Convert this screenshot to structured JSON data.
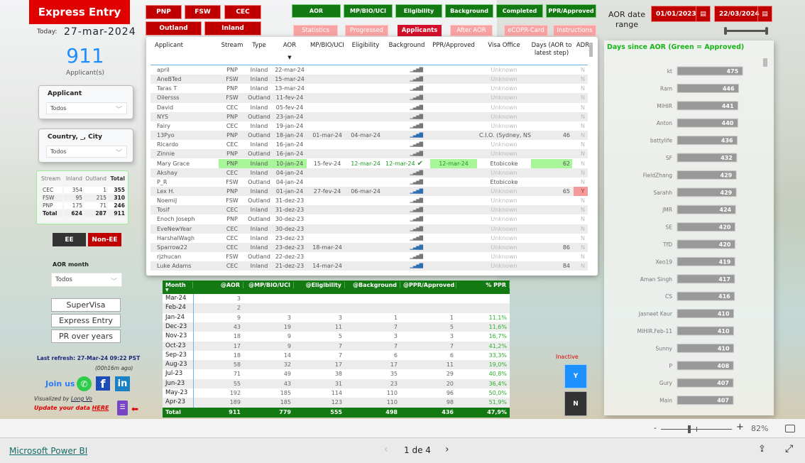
{
  "app": {
    "title": "Express Entry",
    "today_label": "Today:",
    "today": "27-mar-2024",
    "count": "911",
    "count_label": "Applicant(s)"
  },
  "filters": {
    "applicant": {
      "label": "Applicant",
      "value": "Todos"
    },
    "country": {
      "label": "Country, _, City",
      "value": "Todos"
    },
    "aor_month": {
      "label": "AOR month",
      "value": "Todos"
    }
  },
  "stream_matrix": {
    "headers": [
      "Stream",
      "Inland",
      "Outland",
      "Total"
    ],
    "rows": [
      [
        "CEC",
        "354",
        "1",
        "355"
      ],
      [
        "FSW",
        "95",
        "215",
        "310"
      ],
      [
        "PNP",
        "175",
        "71",
        "246"
      ],
      [
        "Total",
        "624",
        "287",
        "911"
      ]
    ]
  },
  "ee_toggle": {
    "ee": "EE",
    "non_ee": "Non-EE"
  },
  "nav_buttons": [
    "SuperVisa",
    "Express Entry",
    "PR over years"
  ],
  "refresh": {
    "text": "Last refresh: 27-Mar-24 09:22 PST",
    "ago": "(00h16m ago)"
  },
  "social": {
    "join": "Join us",
    "icons": [
      "whatsapp-icon",
      "facebook-icon",
      "linkedin-icon"
    ]
  },
  "credits": {
    "prefix": "Visualized by ",
    "author": "Long Vo",
    "update_prefix": "Update your data ",
    "update_link": "HERE"
  },
  "stream_buttons": [
    "PNP",
    "FSW",
    "CEC"
  ],
  "type_buttons": [
    "Outland",
    "Inland"
  ],
  "stage_buttons": [
    "AOR",
    "MP/BIO/UCI",
    "Eligibility",
    "Background",
    "Completed",
    "PPR/Approved"
  ],
  "page_tabs": [
    {
      "label": "Statistics"
    },
    {
      "label": "Progressed"
    },
    {
      "label": "Applicants",
      "active": true
    },
    {
      "label": "After AOR"
    },
    {
      "label": "eCOPR-Card"
    },
    {
      "label": "Instructions"
    }
  ],
  "date_range": {
    "label": "AOR date range",
    "start": "01/01/2023",
    "end": "22/03/2024"
  },
  "applicants_table": {
    "headers": [
      "Applicant",
      "Stream",
      "Type",
      "AOR",
      "MP/BIO/UCI",
      "Eligibility",
      "Background",
      "PPR/Approved",
      "Visa Office",
      "Days (AOR to latest step)",
      "ADR"
    ],
    "sort_column": "AOR",
    "rows": [
      {
        "applicant": "april",
        "stream": "PNP",
        "type": "Inland",
        "aor": "22-mar-24",
        "mp": "",
        "elig": "",
        "bg": "",
        "ppr": "",
        "office": "Unknown",
        "days": "",
        "adr": "N"
      },
      {
        "applicant": "AneBTed",
        "stream": "FSW",
        "type": "Inland",
        "aor": "15-mar-24",
        "mp": "",
        "elig": "",
        "bg": "",
        "ppr": "",
        "office": "Unknown",
        "days": "",
        "adr": "N"
      },
      {
        "applicant": "Taras T",
        "stream": "PNP",
        "type": "Inland",
        "aor": "13-mar-24",
        "mp": "",
        "elig": "",
        "bg": "",
        "ppr": "",
        "office": "Unknown",
        "days": "",
        "adr": "N"
      },
      {
        "applicant": "Oilersss",
        "stream": "FSW",
        "type": "Outland",
        "aor": "11-fev-24",
        "mp": "",
        "elig": "",
        "bg": "",
        "ppr": "",
        "office": "Unknown",
        "days": "",
        "adr": "N"
      },
      {
        "applicant": "David",
        "stream": "CEC",
        "type": "Inland",
        "aor": "05-fev-24",
        "mp": "",
        "elig": "",
        "bg": "",
        "ppr": "",
        "office": "Unknown",
        "days": "",
        "adr": "N"
      },
      {
        "applicant": "NYS",
        "stream": "PNP",
        "type": "Outland",
        "aor": "23-jan-24",
        "mp": "",
        "elig": "",
        "bg": "",
        "ppr": "",
        "office": "Unknown",
        "days": "",
        "adr": "N"
      },
      {
        "applicant": "Fairy",
        "stream": "CEC",
        "type": "Inland",
        "aor": "19-jan-24",
        "mp": "",
        "elig": "",
        "bg": "",
        "ppr": "",
        "office": "Unknown",
        "days": "",
        "adr": "N"
      },
      {
        "applicant": "13Pyo",
        "stream": "PNP",
        "type": "Outland",
        "aor": "18-jan-24",
        "mp": "01-mar-24",
        "elig": "04-mar-24",
        "bg": "",
        "ppr": "",
        "office": "C.I.O. (Sydney, NS)",
        "days": "46",
        "adr": "N",
        "progress": true
      },
      {
        "applicant": "Ricardo",
        "stream": "CEC",
        "type": "Inland",
        "aor": "16-jan-24",
        "mp": "",
        "elig": "",
        "bg": "",
        "ppr": "",
        "office": "Unknown",
        "days": "",
        "adr": "N"
      },
      {
        "applicant": "Zinnie",
        "stream": "PNP",
        "type": "Outland",
        "aor": "16-jan-24",
        "mp": "",
        "elig": "",
        "bg": "",
        "ppr": "",
        "office": "Unknown",
        "days": "",
        "adr": "N"
      },
      {
        "applicant": "Mary Grace",
        "stream": "PNP",
        "type": "Inland",
        "aor": "10-jan-24",
        "mp": "15-fev-24",
        "elig": "12-mar-24",
        "bg": "12-mar-24",
        "ppr": "12-mar-24",
        "office": "Etobicoke",
        "days": "62",
        "adr": "N",
        "approved": true
      },
      {
        "applicant": "Akshay",
        "stream": "CEC",
        "type": "Inland",
        "aor": "04-jan-24",
        "mp": "",
        "elig": "",
        "bg": "",
        "ppr": "",
        "office": "Unknown",
        "days": "",
        "adr": "N"
      },
      {
        "applicant": "P_R",
        "stream": "FSW",
        "type": "Outland",
        "aor": "04-jan-24",
        "mp": "",
        "elig": "",
        "bg": "",
        "ppr": "",
        "office": "Etobicoke",
        "days": "",
        "adr": "N",
        "known_office": true
      },
      {
        "applicant": "Lex H.",
        "stream": "PNP",
        "type": "Inland",
        "aor": "01-jan-24",
        "mp": "27-fev-24",
        "elig": "06-mar-24",
        "bg": "",
        "ppr": "",
        "office": "Unknown",
        "days": "65",
        "adr": "Y",
        "progress": true
      },
      {
        "applicant": "NoemiJ",
        "stream": "FSW",
        "type": "Outland",
        "aor": "31-dez-23",
        "mp": "",
        "elig": "",
        "bg": "",
        "ppr": "",
        "office": "Unknown",
        "days": "",
        "adr": "N"
      },
      {
        "applicant": "Tosif",
        "stream": "CEC",
        "type": "Inland",
        "aor": "31-dez-23",
        "mp": "",
        "elig": "",
        "bg": "",
        "ppr": "",
        "office": "Unknown",
        "days": "",
        "adr": "N"
      },
      {
        "applicant": "Enoch Joseph",
        "stream": "PNP",
        "type": "Outland",
        "aor": "30-dez-23",
        "mp": "",
        "elig": "",
        "bg": "",
        "ppr": "",
        "office": "Unknown",
        "days": "",
        "adr": "N"
      },
      {
        "applicant": "EveNewYear",
        "stream": "CEC",
        "type": "Inland",
        "aor": "30-dez-23",
        "mp": "",
        "elig": "",
        "bg": "",
        "ppr": "",
        "office": "Unknown",
        "days": "",
        "adr": "N"
      },
      {
        "applicant": "HarshalWagh",
        "stream": "CEC",
        "type": "Inland",
        "aor": "23-dez-23",
        "mp": "",
        "elig": "",
        "bg": "",
        "ppr": "",
        "office": "Unknown",
        "days": "",
        "adr": "N"
      },
      {
        "applicant": "Sparrow22",
        "stream": "CEC",
        "type": "Inland",
        "aor": "23-dez-23",
        "mp": "18-mar-24",
        "elig": "",
        "bg": "",
        "ppr": "",
        "office": "Unknown",
        "days": "86",
        "adr": "N",
        "progress": true
      },
      {
        "applicant": "rjzhucan",
        "stream": "FSW",
        "type": "Outland",
        "aor": "22-dez-23",
        "mp": "",
        "elig": "",
        "bg": "",
        "ppr": "",
        "office": "Unknown",
        "days": "",
        "adr": "N"
      },
      {
        "applicant": "Luke Adams",
        "stream": "CEC",
        "type": "Inland",
        "aor": "21-dez-23",
        "mp": "14-mar-24",
        "elig": "",
        "bg": "",
        "ppr": "",
        "office": "Unknown",
        "days": "84",
        "adr": "N",
        "progress": true
      }
    ]
  },
  "monthly_table": {
    "headers": [
      "Month",
      "@AOR",
      "@MP/BIO/UCI",
      "@Eligibility",
      "@Background",
      "@PPR/Approved",
      "% PPR"
    ],
    "rows": [
      [
        "Mar-24",
        "3",
        "",
        "",
        "",
        "",
        ""
      ],
      [
        "Feb-24",
        "2",
        "",
        "",
        "",
        "",
        ""
      ],
      [
        "Jan-24",
        "9",
        "3",
        "3",
        "1",
        "1",
        "11,1%"
      ],
      [
        "Dec-23",
        "43",
        "19",
        "11",
        "7",
        "5",
        "11,6%"
      ],
      [
        "Nov-23",
        "18",
        "9",
        "5",
        "3",
        "3",
        "16,7%"
      ],
      [
        "Oct-23",
        "17",
        "9",
        "7",
        "7",
        "7",
        "41,2%"
      ],
      [
        "Sep-23",
        "18",
        "14",
        "7",
        "6",
        "6",
        "33,3%"
      ],
      [
        "Aug-23",
        "58",
        "32",
        "17",
        "17",
        "11",
        "19,0%"
      ],
      [
        "Jul-23",
        "71",
        "49",
        "38",
        "35",
        "29",
        "40,8%"
      ],
      [
        "Jun-23",
        "55",
        "43",
        "31",
        "23",
        "20",
        "36,4%"
      ],
      [
        "May-23",
        "192",
        "185",
        "114",
        "110",
        "96",
        "50,0%"
      ],
      [
        "Apr-23",
        "189",
        "185",
        "123",
        "110",
        "98",
        "51,9%"
      ]
    ],
    "total": [
      "Total",
      "911",
      "779",
      "555",
      "498",
      "436",
      "47,9%"
    ]
  },
  "chart_data": {
    "type": "bar",
    "orientation": "horizontal",
    "title": "Days since AOR (Green = Approved)",
    "categories": [
      "kt",
      "Ram",
      "MIHIR",
      "Anton",
      "battylife",
      "SF",
      "FieldZhang",
      "Sarahh",
      "JMR",
      "SE",
      "TfD",
      "Xeo19",
      "Aman Singh",
      "CS",
      "Jasneet Kaur",
      "MIHIR.Feb-11",
      "Sunny",
      "P",
      "Gury",
      "Main"
    ],
    "values": [
      475,
      446,
      441,
      440,
      436,
      432,
      429,
      429,
      424,
      420,
      420,
      419,
      417,
      416,
      410,
      410,
      410,
      408,
      407,
      407
    ],
    "bar_color": "#999999",
    "grid": false,
    "data_labels": true
  },
  "inactive": {
    "label": "Inactive",
    "yes": "Y",
    "no": "N"
  },
  "zoom": {
    "minus": "-",
    "plus": "+",
    "level": "82%",
    "value_fraction": 0.4
  },
  "footer": {
    "brand": "Microsoft Power BI",
    "page": "1 de 4"
  },
  "colors": {
    "brand_red": "#c00000",
    "green": "#137a13",
    "blue": "#1e90ff",
    "approved": "#a9f59a",
    "adr_yes": "#f59a9a"
  }
}
